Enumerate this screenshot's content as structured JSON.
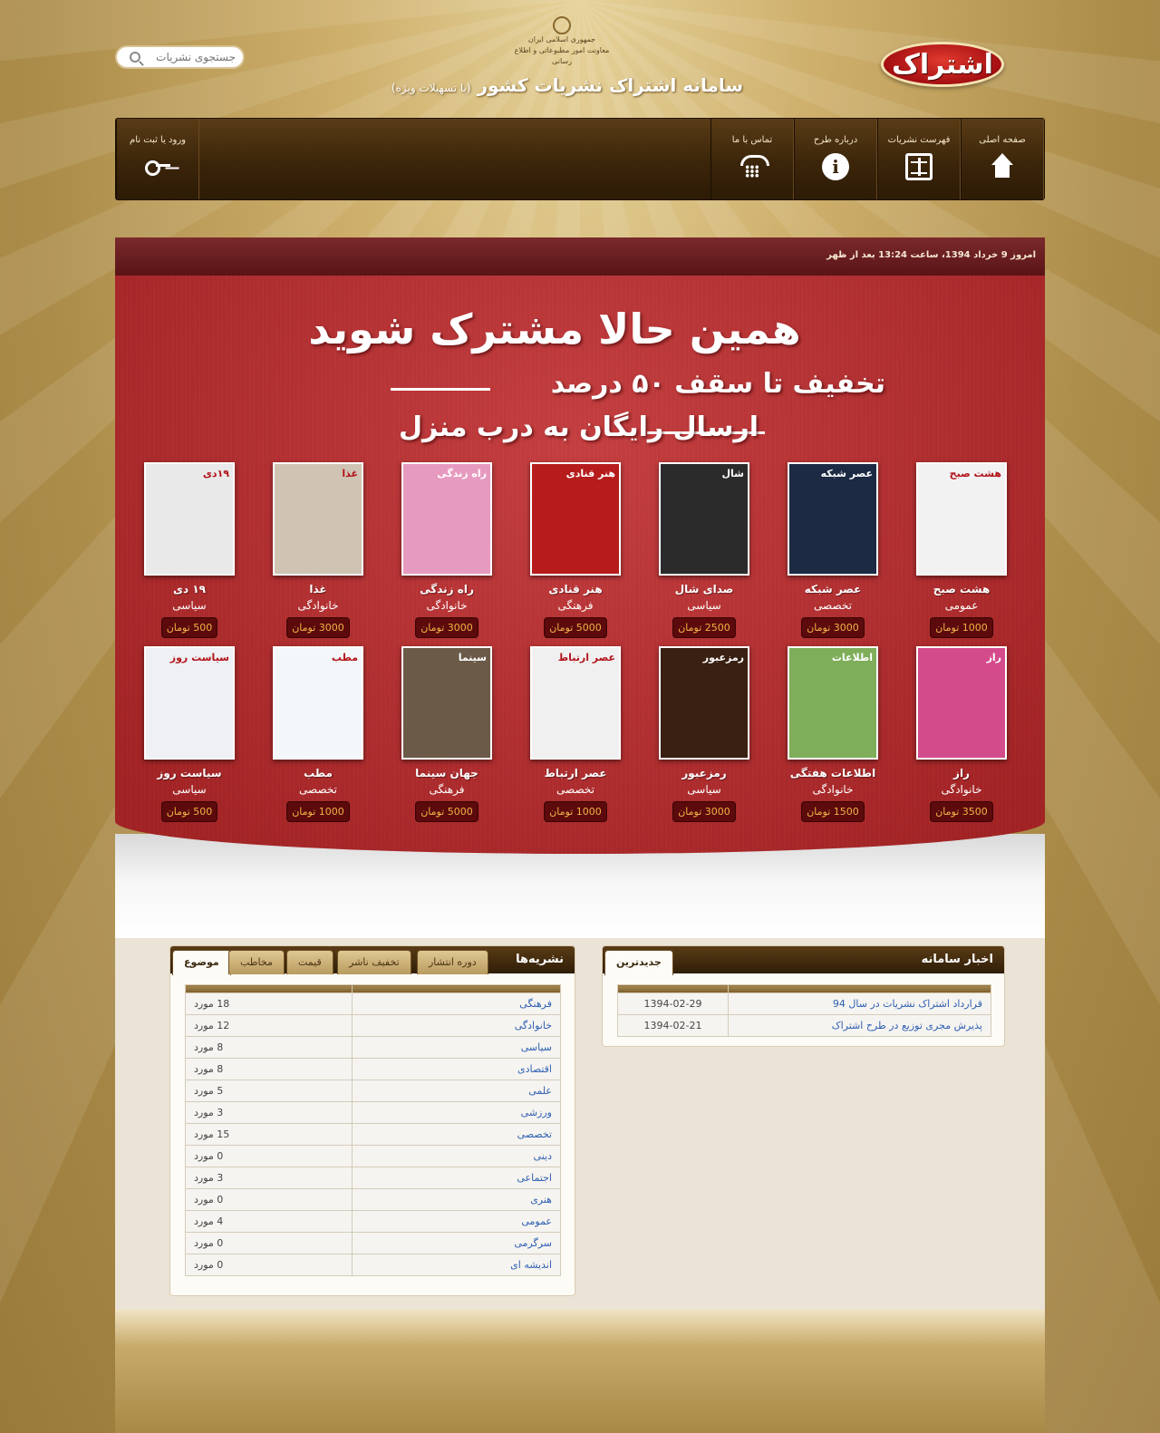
{
  "header": {
    "logo_text": "اشتراک",
    "emblem_line1": "جمهوری اسلامی ایران",
    "emblem_line2": "معاونت امور مطبوعاتی و اطلاع رسانی",
    "site_title": "سامانه اشتراک نشریات کشور",
    "site_title_suffix": "(با تسهیلات ویژه)",
    "search_placeholder": "جستجوی نشریات"
  },
  "nav": {
    "items": [
      {
        "label": "صفحه اصلی",
        "icon": "home-icon"
      },
      {
        "label": "فهرست نشریات",
        "icon": "book-icon"
      },
      {
        "label": "درباره طرح",
        "icon": "info-icon"
      },
      {
        "label": "تماس با ما",
        "icon": "phone-icon"
      }
    ],
    "login_label": "ورود یا ثبت نام",
    "login_icon": "key-icon"
  },
  "datebar": {
    "text": "امروز 9 خرداد 1394، ساعت 13:24 بعد از ظهر"
  },
  "banner": {
    "headline": "همین حالا مشترک شوید",
    "line2": "تخفیف تا سقف ۵۰ درصد",
    "line3": "ارسال رایگان به درب منزل"
  },
  "magazines_row1": [
    {
      "name": "هشت صبح",
      "category": "عمومی",
      "price": "1000 تومان",
      "cover_color": "#f2f2f2",
      "mast": "هشت صبح"
    },
    {
      "name": "عصر شبکه",
      "category": "تخصصی",
      "price": "3000 تومان",
      "cover_color": "#1c2a44",
      "mast": "عصر شبکه"
    },
    {
      "name": "صدای شال",
      "category": "سیاسی",
      "price": "2500 تومان",
      "cover_color": "#2b2b2b",
      "mast": "شال"
    },
    {
      "name": "هنر قنادی",
      "category": "فرهنگی",
      "price": "5000 تومان",
      "cover_color": "#b71c1c",
      "mast": "هنر قنادی"
    },
    {
      "name": "راه زندگی",
      "category": "خانوادگی",
      "price": "3000 تومان",
      "cover_color": "#e79abf",
      "mast": "راه زندگی"
    },
    {
      "name": "غذا",
      "category": "خانوادگی",
      "price": "3000 تومان",
      "cover_color": "#cfc4b3",
      "mast": "غذا"
    },
    {
      "name": "۱۹ دی",
      "category": "سیاسی",
      "price": "500 تومان",
      "cover_color": "#e9e9e9",
      "mast": "۱۹دی"
    }
  ],
  "magazines_row2": [
    {
      "name": "راز",
      "category": "خانوادگی",
      "price": "3500 تومان",
      "cover_color": "#d44b8c",
      "mast": "راز"
    },
    {
      "name": "اطلاعات هفتگی",
      "category": "خانوادگی",
      "price": "1500 تومان",
      "cover_color": "#7fae5b",
      "mast": "اطلاعات"
    },
    {
      "name": "رمزعبور",
      "category": "سیاسی",
      "price": "3000 تومان",
      "cover_color": "#3a2012",
      "mast": "رمزعبور"
    },
    {
      "name": "عصر ارتباط",
      "category": "تخصصی",
      "price": "1000 تومان",
      "cover_color": "#f0f0f0",
      "mast": "عصر ارتباط"
    },
    {
      "name": "جهان سینما",
      "category": "فرهنگی",
      "price": "5000 تومان",
      "cover_color": "#6b5a48",
      "mast": "سینما"
    },
    {
      "name": "مطب",
      "category": "تخصصی",
      "price": "1000 تومان",
      "cover_color": "#f4f7f9",
      "mast": "مطب"
    },
    {
      "name": "سیاست روز",
      "category": "سیاسی",
      "price": "500 تومان",
      "cover_color": "#eef0f3",
      "mast": "سیاست روز"
    }
  ],
  "publications_box": {
    "title": "نشریه‌ها",
    "tabs": [
      "موضوع",
      "مخاطب",
      "قیمت",
      "تخفیف ناشر",
      "دوره انتشار"
    ],
    "rows": [
      {
        "subject": "فرهنگی",
        "count": "18 مورد"
      },
      {
        "subject": "خانوادگی",
        "count": "12 مورد"
      },
      {
        "subject": "سیاسی",
        "count": "8 مورد"
      },
      {
        "subject": "اقتصادی",
        "count": "8 مورد"
      },
      {
        "subject": "علمی",
        "count": "5 مورد"
      },
      {
        "subject": "ورزشی",
        "count": "3 مورد"
      },
      {
        "subject": "تخصصی",
        "count": "15 مورد"
      },
      {
        "subject": "دینی",
        "count": "0 مورد"
      },
      {
        "subject": "اجتماعی",
        "count": "3 مورد"
      },
      {
        "subject": "هنری",
        "count": "0 مورد"
      },
      {
        "subject": "عمومی",
        "count": "4 مورد"
      },
      {
        "subject": "سرگرمی",
        "count": "0 مورد"
      },
      {
        "subject": "اندیشه ای",
        "count": "0 مورد"
      }
    ]
  },
  "news_box": {
    "title": "اخبار سامانه",
    "tab": "جدیدترین",
    "rows": [
      {
        "title": "قرارداد اشتراک نشریات در سال 94",
        "date": "1394-02-29"
      },
      {
        "title": "پذیرش مجری توزیع در طرح اشتراک",
        "date": "1394-02-21"
      }
    ]
  },
  "colors": {
    "nav_bg": "#3b250a",
    "banner_red": "#c12c2f",
    "price_bg": "#5c0a0c",
    "price_text": "#f6b244",
    "link_blue": "#2d5fb3"
  }
}
